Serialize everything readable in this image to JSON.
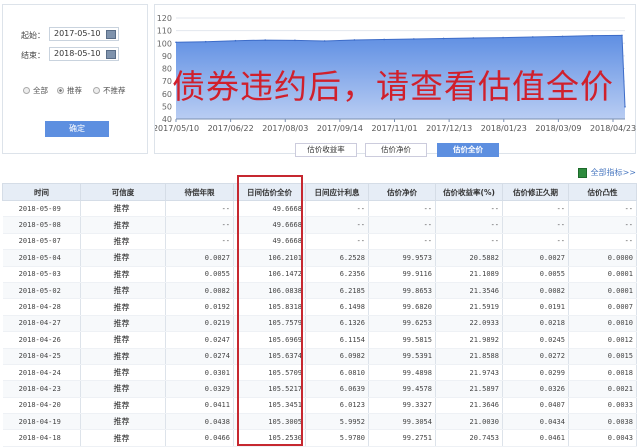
{
  "filter": {
    "start_label": "起始：",
    "start_value": "2017-05-10",
    "end_label": "结束：",
    "end_value": "2018-05-10",
    "radios": [
      {
        "label": "全部",
        "checked": false
      },
      {
        "label": "推荐",
        "checked": true
      },
      {
        "label": "不推荐",
        "checked": false
      }
    ],
    "confirm_label": "确定"
  },
  "chart_tabs": [
    "估价收益率",
    "估价净价",
    "估价全价"
  ],
  "active_tab": 2,
  "overlay_text": "债券违约后，请查看估值全价",
  "all_indicators": "全部指标>>",
  "chart_data": {
    "type": "area",
    "title": "",
    "xlabel": "",
    "ylabel": "",
    "ylim": [
      40,
      120
    ],
    "yticks": [
      40,
      50,
      60,
      70,
      80,
      90,
      100,
      110,
      120
    ],
    "xticks": [
      "2017/05/10",
      "2017/06/22",
      "2017/08/03",
      "2017/09/14",
      "2017/11/01",
      "2017/12/13",
      "2018/01/23",
      "2018/03/09",
      "2018/04/23"
    ],
    "series": [
      {
        "name": "估价全价",
        "values": [
          100.8,
          101.2,
          102.0,
          102.5,
          102.3,
          101.8,
          102.6,
          103.0,
          103.4,
          103.8,
          104.2,
          104.5,
          105.0,
          105.4,
          106.0,
          106.2,
          49.67
        ]
      }
    ],
    "color": "#6f9ae6"
  },
  "table": {
    "headers": [
      "时间",
      "可信度",
      "待偿年限",
      "日间估价全价",
      "日间应计利息",
      "估价净价",
      "估价收益率(%)",
      "估价修正久期",
      "估价凸性"
    ],
    "rows": [
      [
        "2018-05-09",
        "推荐",
        "--",
        "49.6668",
        "--",
        "--",
        "--",
        "--",
        "--"
      ],
      [
        "2018-05-08",
        "推荐",
        "--",
        "49.6668",
        "--",
        "--",
        "--",
        "--",
        "--"
      ],
      [
        "2018-05-07",
        "推荐",
        "--",
        "49.6668",
        "--",
        "--",
        "--",
        "--",
        "--"
      ],
      [
        "2018-05-04",
        "推荐",
        "0.0027",
        "106.2101",
        "6.2528",
        "99.9573",
        "20.5882",
        "0.0027",
        "0.0000"
      ],
      [
        "2018-05-03",
        "推荐",
        "0.0055",
        "106.1472",
        "6.2356",
        "99.9116",
        "21.1089",
        "0.0055",
        "0.0001"
      ],
      [
        "2018-05-02",
        "推荐",
        "0.0082",
        "106.0838",
        "6.2185",
        "99.8653",
        "21.3546",
        "0.0082",
        "0.0001"
      ],
      [
        "2018-04-28",
        "推荐",
        "0.0192",
        "105.8318",
        "6.1498",
        "99.6820",
        "21.5919",
        "0.0191",
        "0.0007"
      ],
      [
        "2018-04-27",
        "推荐",
        "0.0219",
        "105.7579",
        "6.1326",
        "99.6253",
        "22.0933",
        "0.0218",
        "0.0010"
      ],
      [
        "2018-04-26",
        "推荐",
        "0.0247",
        "105.6969",
        "6.1154",
        "99.5815",
        "21.9892",
        "0.0245",
        "0.0012"
      ],
      [
        "2018-04-25",
        "推荐",
        "0.0274",
        "105.6374",
        "6.0982",
        "99.5391",
        "21.8588",
        "0.0272",
        "0.0015"
      ],
      [
        "2018-04-24",
        "推荐",
        "0.0301",
        "105.5709",
        "6.0810",
        "99.4898",
        "21.9743",
        "0.0299",
        "0.0018"
      ],
      [
        "2018-04-23",
        "推荐",
        "0.0329",
        "105.5217",
        "6.0639",
        "99.4578",
        "21.5897",
        "0.0326",
        "0.0021"
      ],
      [
        "2018-04-20",
        "推荐",
        "0.0411",
        "105.3451",
        "6.0123",
        "99.3327",
        "21.3646",
        "0.0407",
        "0.0033"
      ],
      [
        "2018-04-19",
        "推荐",
        "0.0438",
        "105.3005",
        "5.9952",
        "99.3054",
        "21.0030",
        "0.0434",
        "0.0038"
      ],
      [
        "2018-04-18",
        "推荐",
        "0.0466",
        "105.2530",
        "5.9780",
        "99.2751",
        "20.7453",
        "0.0461",
        "0.0043"
      ]
    ]
  }
}
